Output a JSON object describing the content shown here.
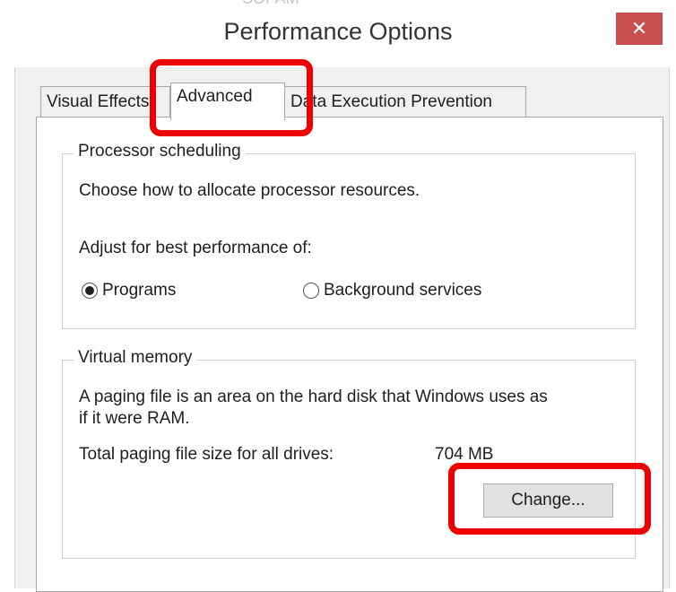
{
  "window": {
    "title": "Performance Options",
    "partial_title_behind": "SOPAM"
  },
  "tabs": [
    {
      "label": "Visual Effects"
    },
    {
      "label": "Advanced"
    },
    {
      "label": "Data Execution Prevention"
    }
  ],
  "processor": {
    "legend": "Processor scheduling",
    "description": "Choose how to allocate processor resources.",
    "adjust_label": "Adjust for best performance of:",
    "option_programs": "Programs",
    "option_background": "Background services",
    "selected": "Programs"
  },
  "virtual_memory": {
    "legend": "Virtual memory",
    "description_line1": "A paging file is an area on the hard disk that Windows uses as",
    "description_line2": "if it were RAM.",
    "total_label": "Total paging file size for all drives:",
    "total_value": "704 MB",
    "change_button": "Change..."
  },
  "colors": {
    "highlight": "#ee0000",
    "close_button": "#c94f4f",
    "window_bg": "#f0f0f0"
  },
  "icons": {
    "close": "close-icon"
  }
}
